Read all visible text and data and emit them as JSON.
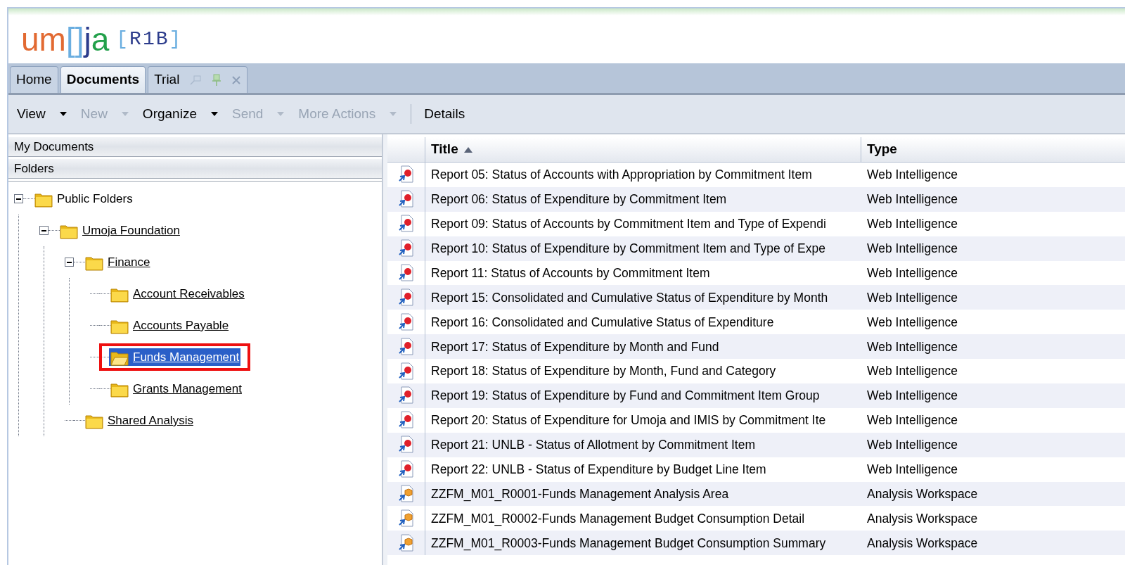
{
  "logo": {
    "name_parts": [
      {
        "text": "um",
        "color": "#e26a32"
      },
      {
        "text": "[]",
        "color": "#6aaee0"
      },
      {
        "text": "j",
        "color": "#2c3c8c"
      },
      {
        "text": "a",
        "color": "#22a04a"
      }
    ],
    "tag_parts": [
      {
        "text": "[",
        "color": "#6aaee0"
      },
      {
        "text": "R1B",
        "color": "#2c3c8c"
      },
      {
        "text": "]",
        "color": "#6aaee0"
      }
    ]
  },
  "tabs": [
    {
      "label": "Home",
      "selected": false,
      "kind": "plain"
    },
    {
      "label": "Documents",
      "selected": true,
      "kind": "plain"
    },
    {
      "label": "Trial",
      "selected": false,
      "kind": "tools"
    }
  ],
  "toolbar": [
    {
      "label": "View",
      "disabled": false,
      "dropdown": true
    },
    {
      "label": "New",
      "disabled": true,
      "dropdown": true
    },
    {
      "label": "Organize",
      "disabled": false,
      "dropdown": true
    },
    {
      "label": "Send",
      "disabled": true,
      "dropdown": true
    },
    {
      "label": "More Actions",
      "disabled": true,
      "dropdown": true
    },
    {
      "label": "Details",
      "disabled": false,
      "dropdown": false
    }
  ],
  "sidebar": {
    "sections": [
      "My Documents",
      "Folders"
    ],
    "tree": [
      {
        "label": "Public Folders",
        "expanded": true,
        "selected": false,
        "link": false,
        "annotated": false,
        "children": [
          {
            "label": "Umoja Foundation",
            "expanded": true,
            "selected": false,
            "link": true,
            "annotated": false,
            "children": [
              {
                "label": "Finance",
                "expanded": true,
                "selected": false,
                "link": true,
                "annotated": false,
                "children": [
                  {
                    "label": "Account Receivables",
                    "selected": false,
                    "link": true,
                    "annotated": false
                  },
                  {
                    "label": "Accounts Payable",
                    "selected": false,
                    "link": true,
                    "annotated": false
                  },
                  {
                    "label": "Funds Management",
                    "selected": true,
                    "link": true,
                    "annotated": true
                  },
                  {
                    "label": "Grants Management",
                    "selected": false,
                    "link": true,
                    "annotated": false
                  }
                ]
              },
              {
                "label": "Shared Analysis",
                "selected": false,
                "link": true,
                "annotated": false
              }
            ]
          }
        ]
      }
    ]
  },
  "table": {
    "columns": [
      {
        "label": "Title",
        "sorted": true
      },
      {
        "label": "Type",
        "sorted": false
      }
    ],
    "rows": [
      {
        "kind": "report",
        "title": "Report 05: Status of Accounts with Appropriation by Commitment Item",
        "type": "Web Intelligence"
      },
      {
        "kind": "report",
        "title": "Report 06: Status of Expenditure by Commitment Item",
        "type": "Web Intelligence"
      },
      {
        "kind": "report",
        "title": "Report 09: Status of Accounts by Commitment Item and Type of Expendi",
        "type": "Web Intelligence"
      },
      {
        "kind": "report",
        "title": "Report 10: Status of Expenditure by Commitment Item and Type of Expe",
        "type": "Web Intelligence"
      },
      {
        "kind": "report",
        "title": "Report 11: Status of Accounts by Commitment Item",
        "type": "Web Intelligence"
      },
      {
        "kind": "report",
        "title": "Report 15: Consolidated and Cumulative Status of Expenditure by Month",
        "type": "Web Intelligence"
      },
      {
        "kind": "report",
        "title": "Report 16: Consolidated and Cumulative Status of Expenditure",
        "type": "Web Intelligence"
      },
      {
        "kind": "report",
        "title": "Report 17: Status of Expenditure by Month and Fund",
        "type": "Web Intelligence"
      },
      {
        "kind": "report",
        "title": "Report 18: Status of Expenditure by Month, Fund and Category",
        "type": "Web Intelligence"
      },
      {
        "kind": "report",
        "title": "Report 19: Status of Expenditure by Fund and Commitment Item Group",
        "type": "Web Intelligence"
      },
      {
        "kind": "report",
        "title": "Report 20: Status of Expenditure for Umoja and IMIS by Commitment Ite",
        "type": "Web Intelligence"
      },
      {
        "kind": "report",
        "title": "Report 21: UNLB - Status of Allotment by Commitment Item",
        "type": "Web Intelligence"
      },
      {
        "kind": "report",
        "title": "Report 22: UNLB - Status of Expenditure by Budget Line Item",
        "type": "Web Intelligence"
      },
      {
        "kind": "workspace",
        "title": "ZZFM_M01_R0001-Funds Management Analysis Area",
        "type": "Analysis Workspace"
      },
      {
        "kind": "workspace",
        "title": "ZZFM_M01_R0002-Funds Management Budget Consumption Detail",
        "type": "Analysis Workspace"
      },
      {
        "kind": "workspace",
        "title": "ZZFM_M01_R0003-Funds Management Budget Consumption Summary",
        "type": "Analysis Workspace"
      }
    ]
  }
}
